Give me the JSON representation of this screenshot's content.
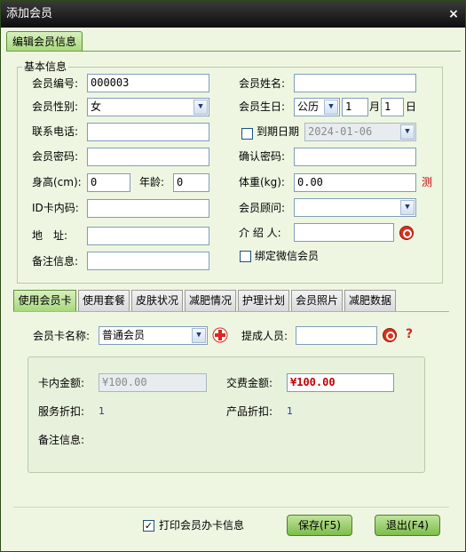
{
  "window": {
    "title": "添加会员",
    "close_glyph": "×"
  },
  "top_tab": {
    "label": "编辑会员信息"
  },
  "basic_info": {
    "legend": "基本信息",
    "member_no_label": "会员编号:",
    "member_no_value": "000003",
    "member_name_label": "会员姓名:",
    "member_name_value": "",
    "gender_label": "会员性别:",
    "gender_value": "女",
    "birthday_label": "会员生日:",
    "calendar_value": "公历",
    "month_value": "1",
    "month_unit": "月",
    "day_value": "1",
    "day_unit": "日",
    "phone_label": "联系电话:",
    "phone_value": "",
    "expiry_label": "到期日期",
    "expiry_checked": false,
    "expiry_value": "2024-01-06",
    "password_label": "会员密码:",
    "password_value": "",
    "confirm_label": "确认密码:",
    "confirm_value": "",
    "height_label": "身高(cm):",
    "height_value": "0",
    "age_label": "年龄:",
    "age_value": "0",
    "weight_label": "体重(kg):",
    "weight_value": "0.00",
    "weight_link": "测",
    "idcard_label": "ID卡内码:",
    "idcard_value": "",
    "advisor_label": "会员顾问:",
    "advisor_value": "",
    "address_label": "地　址:",
    "address_value": "",
    "referrer_label": "介 绍 人:",
    "referrer_value": "",
    "note_label": "备注信息:",
    "note_value": "",
    "wechat_label": "绑定微信会员",
    "wechat_checked": false
  },
  "tabs": [
    {
      "label": "使用会员卡",
      "active": true
    },
    {
      "label": "使用套餐",
      "active": false
    },
    {
      "label": "皮肤状况",
      "active": false
    },
    {
      "label": "减肥情况",
      "active": false
    },
    {
      "label": "护理计划",
      "active": false
    },
    {
      "label": "会员照片",
      "active": false
    },
    {
      "label": "减肥数据",
      "active": false
    }
  ],
  "card_panel": {
    "card_name_label": "会员卡名称:",
    "card_name_value": "普通会员",
    "commission_label": "提成人员:",
    "commission_value": "",
    "help_glyph": "?",
    "balance_label": "卡内金额:",
    "balance_value": "¥100.00",
    "fee_label": "交费金额:",
    "fee_value": "¥100.00",
    "service_discount_label": "服务折扣:",
    "service_discount_value": "1",
    "product_discount_label": "产品折扣:",
    "product_discount_value": "1",
    "note_label": "备注信息:"
  },
  "footer": {
    "print_label": "打印会员办卡信息",
    "print_checked": true,
    "save_label": "保存(F5)",
    "exit_label": "退出(F4)"
  },
  "colors": {
    "accent_green": "#a9d87e",
    "fee_red": "#c00000",
    "value_blue": "#1a3ea8"
  }
}
